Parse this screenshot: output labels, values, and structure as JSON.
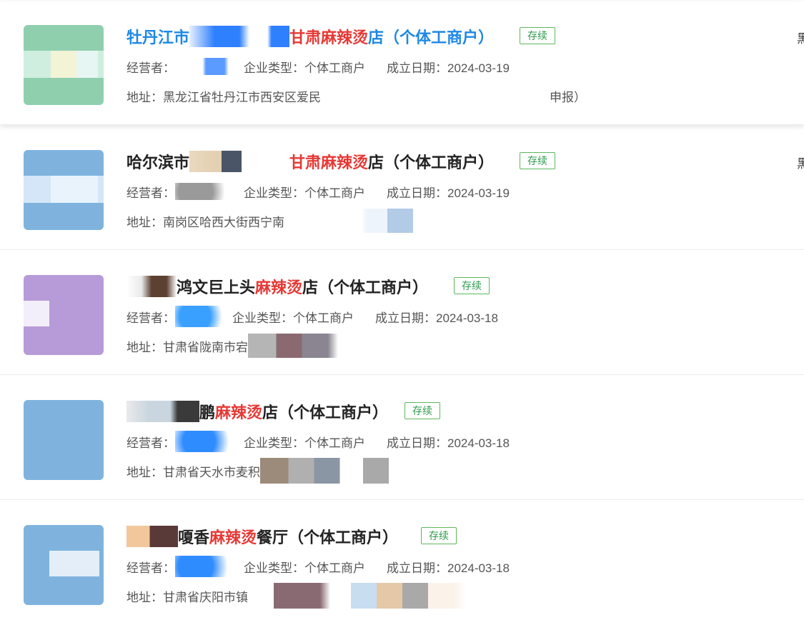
{
  "results": [
    {
      "title_pre": "牡丹江市",
      "title_kw": "甘肃麻辣烫",
      "title_post": "店（个体工商户）",
      "status": "存续",
      "operator_label": "经营者：",
      "type_text": "企业类型：个体工商户",
      "date_text": "成立日期：2024-03-19",
      "address_pre": "地址：黑龙江省牡丹江市西安区爱民",
      "address_post": "申报）",
      "edge_char": "黑"
    },
    {
      "title_pre": "哈尔滨市",
      "title_kw": "甘肃麻辣烫",
      "title_post": "店（个体工商户）",
      "status": "存续",
      "operator_label": "经营者：",
      "type_text": "企业类型：个体工商户",
      "date_text": "成立日期：2024-03-19",
      "address_pre": "地址：南岗区哈西大街西宁南",
      "address_post": "",
      "edge_char": "黑"
    },
    {
      "title_pre": "鸿文巨上头",
      "title_kw": "麻辣烫",
      "title_post": "店（个体工商户）",
      "status": "存续",
      "operator_label": "经营者：",
      "type_text": "企业类型：个体工商户",
      "date_text": "成立日期：2024-03-18",
      "address_pre": "地址：甘肃省陇南市宕",
      "address_post": "",
      "edge_char": ""
    },
    {
      "title_pre": "鹏",
      "title_kw": "麻辣烫",
      "title_post": "店（个体工商户）",
      "status": "存续",
      "operator_label": "经营者：",
      "type_text": "企业类型：个体工商户",
      "date_text": "成立日期：2024-03-18",
      "address_pre": "地址：甘肃省天水市麦积",
      "address_post": "",
      "edge_char": ""
    },
    {
      "title_pre": "嗄香",
      "title_kw": "麻辣烫",
      "title_post": "餐厅（个体工商户）",
      "status": "存续",
      "operator_label": "经营者：",
      "type_text": "企业类型：个体工商户",
      "date_text": "成立日期：2024-03-18",
      "address_pre": "地址：甘肃省庆阳市镇",
      "address_post": "",
      "edge_char": ""
    }
  ],
  "colors": {
    "link_blue": "#1e88e5",
    "keyword_red": "#e53935",
    "status_green": "#2e9b4e"
  }
}
